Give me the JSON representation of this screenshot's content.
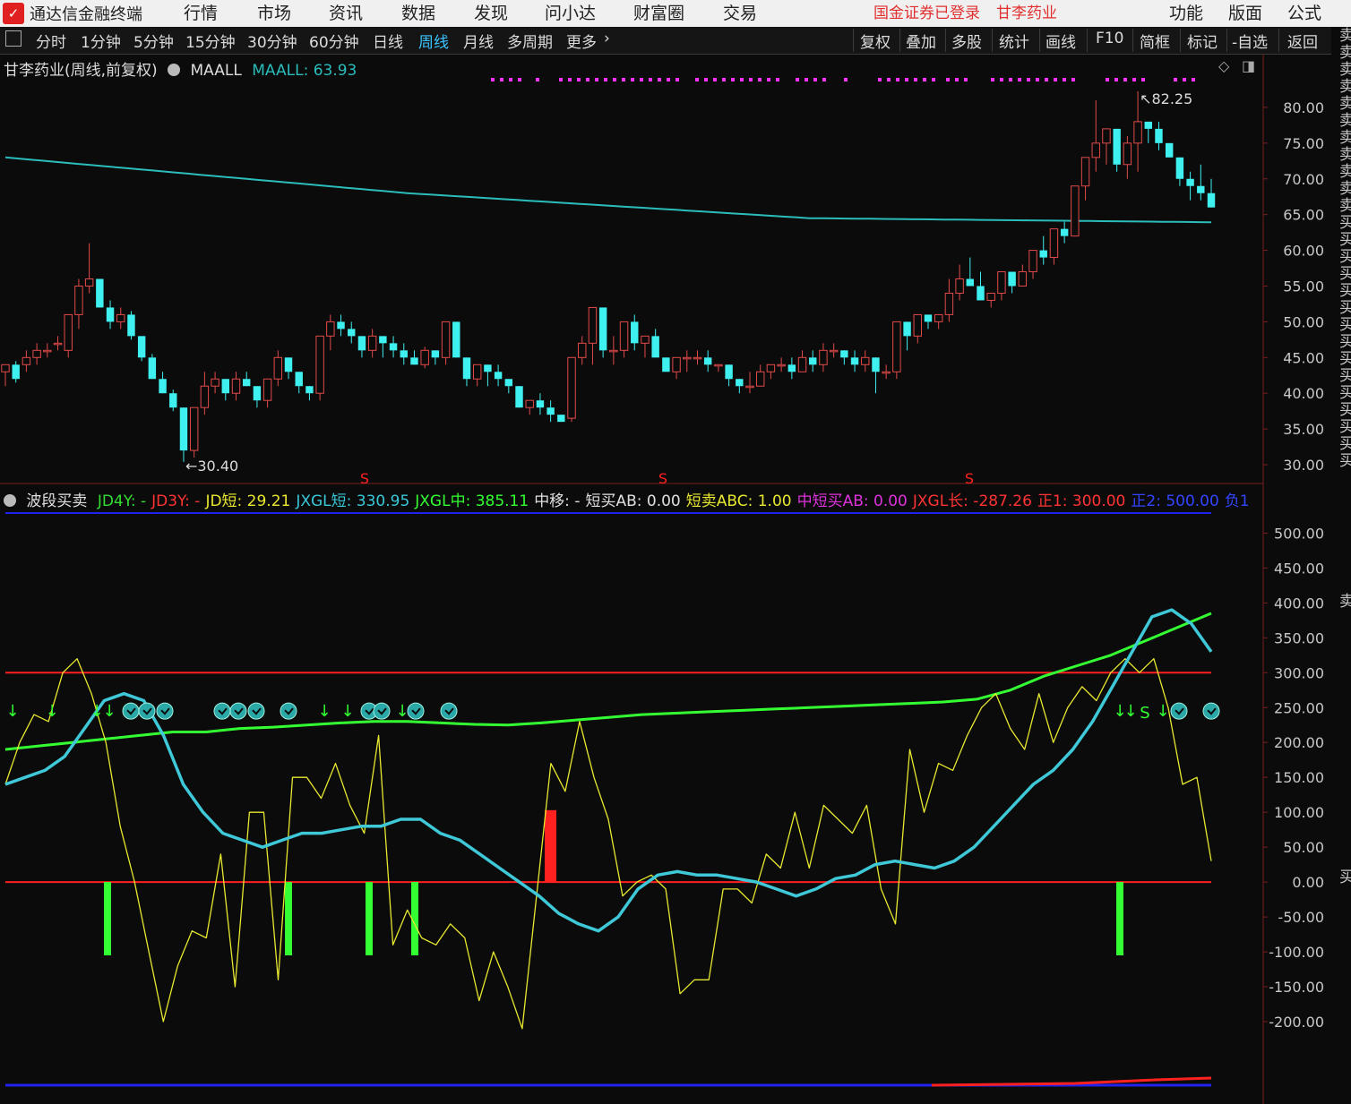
{
  "app": {
    "logo_text": "✓",
    "title": "通达信金融终端",
    "login_status": "国金证券已登录",
    "stock_name": "甘李药业"
  },
  "menu": {
    "main": [
      "行情",
      "市场",
      "资讯",
      "数据",
      "发现",
      "问小达",
      "财富圈",
      "交易"
    ],
    "right": [
      "功能",
      "版面",
      "公式"
    ]
  },
  "toolbar": {
    "periods": [
      "分时",
      "1分钟",
      "5分钟",
      "15分钟",
      "30分钟",
      "60分钟",
      "日线",
      "周线",
      "月线",
      "多周期",
      "更多"
    ],
    "selected": "周线",
    "right_buttons": [
      "复权",
      "叠加",
      "多股",
      "统计",
      "画线",
      "F10",
      "简框",
      "标记",
      "-自选",
      "返回"
    ]
  },
  "main_chart": {
    "title": "甘李药业(周线,前复权)",
    "indicator_name": "MAALL",
    "indicator_label": "MAALL: 63.93",
    "high_marker": "82.25",
    "low_marker": "30.40",
    "signal_marker": "S",
    "y_ticks": [
      "80.00",
      "75.00",
      "70.00",
      "65.00",
      "60.00",
      "55.00",
      "50.00",
      "45.00",
      "40.00",
      "35.00",
      "30.00"
    ]
  },
  "sub_chart": {
    "name": "波段买卖",
    "fields": [
      {
        "text": "JD4Y: -",
        "color": "#33dd33"
      },
      {
        "text": "JD3Y: -",
        "color": "#ff3333"
      },
      {
        "text": "JD短: 29.21",
        "color": "#e8e830"
      },
      {
        "text": "JXGL短: 330.95",
        "color": "#39c8d8"
      },
      {
        "text": "JXGL中: 385.11",
        "color": "#33ff33"
      },
      {
        "text": "中移: -",
        "color": "#e0e0e0"
      },
      {
        "text": "短买AB: 0.00",
        "color": "#e0e0e0"
      },
      {
        "text": "短卖ABC: 1.00",
        "color": "#e8e830"
      },
      {
        "text": "中短买AB: 0.00",
        "color": "#dd33dd"
      },
      {
        "text": "JXGL长: -287.26",
        "color": "#ff3333"
      },
      {
        "text": "正1: 300.00",
        "color": "#ff3333"
      },
      {
        "text": "正2: 500.00",
        "color": "#3344ff"
      },
      {
        "text": "负1",
        "color": "#3344ff"
      }
    ],
    "y_ticks": [
      "500.00",
      "450.00",
      "400.00",
      "350.00",
      "300.00",
      "250.00",
      "200.00",
      "150.00",
      "100.00",
      "50.00",
      "0.00",
      "-50.00",
      "-100.00",
      "-150.00",
      "-200.00"
    ]
  },
  "right_strip": {
    "top": "卖卖卖卖卖卖卖卖卖卖卖买买买买买买买买买买买买买买买",
    "mid": "卖",
    "low": "买"
  },
  "colors": {
    "up": "#e24a4a",
    "down": "#3ff0f0",
    "ma": "#2bbcbc",
    "yellow": "#e8e830",
    "cyan": "#3ec8d8",
    "green": "#33ff33",
    "red": "#ff2020",
    "blue": "#2222ee",
    "magenta": "#ff33ff"
  },
  "chart_data": [
    {
      "type": "candlestick",
      "title": "甘李药业(周线,前复权)",
      "ylim": [
        28,
        84
      ],
      "series": [
        {
          "name": "K线",
          "ohlc": [
            [
              43,
              44,
              41,
              44
            ],
            [
              44,
              44.5,
              41.5,
              42
            ],
            [
              44,
              46,
              43,
              45
            ],
            [
              45,
              47,
              44,
              46
            ],
            [
              46,
              47,
              45,
              46
            ],
            [
              47,
              48,
              46,
              47
            ],
            [
              46,
              51,
              45,
              51
            ],
            [
              51,
              56,
              49,
              55
            ],
            [
              55,
              61,
              54,
              56
            ],
            [
              56,
              56,
              52,
              52
            ],
            [
              52,
              53,
              49,
              50
            ],
            [
              50,
              52,
              49,
              51
            ],
            [
              51,
              51.5,
              47.5,
              48
            ],
            [
              48,
              48,
              44.5,
              45
            ],
            [
              45,
              45.5,
              42,
              42
            ],
            [
              42,
              43,
              40,
              40
            ],
            [
              40,
              40.5,
              37.5,
              38
            ],
            [
              38,
              38,
              30.4,
              32
            ],
            [
              32,
              38,
              31,
              38
            ],
            [
              38,
              43,
              37,
              41
            ],
            [
              41,
              43,
              40,
              42
            ],
            [
              42,
              42,
              39,
              40
            ],
            [
              40,
              43,
              39,
              42
            ],
            [
              42,
              43,
              41,
              41
            ],
            [
              41,
              41,
              38,
              39
            ],
            [
              39,
              42,
              38,
              42
            ],
            [
              42,
              46,
              41,
              45
            ],
            [
              45,
              45,
              42,
              43
            ],
            [
              43,
              43,
              40,
              41
            ],
            [
              41,
              41,
              39,
              40
            ],
            [
              40,
              47,
              39,
              48
            ],
            [
              48,
              51,
              46,
              50
            ],
            [
              50,
              51,
              48,
              49
            ],
            [
              49,
              50,
              47,
              48
            ],
            [
              48,
              48,
              45,
              46
            ],
            [
              46,
              49,
              45,
              48
            ],
            [
              48,
              48,
              45,
              47
            ],
            [
              47,
              48,
              45,
              46
            ],
            [
              46,
              47,
              44,
              45
            ],
            [
              45,
              46,
              44,
              44
            ],
            [
              44,
              46.5,
              43.5,
              46
            ],
            [
              46,
              46,
              44,
              45
            ],
            [
              45,
              50,
              44,
              50
            ],
            [
              50,
              50,
              45,
              45
            ],
            [
              45,
              45,
              41,
              42
            ],
            [
              42,
              44,
              41,
              44
            ],
            [
              44,
              44,
              41,
              43
            ],
            [
              43,
              44,
              41,
              42
            ],
            [
              42,
              42,
              40,
              41
            ],
            [
              41,
              41,
              38,
              38
            ],
            [
              38,
              39,
              37,
              39
            ],
            [
              39,
              40,
              37,
              38
            ],
            [
              38,
              39,
              36,
              37
            ],
            [
              37,
              37,
              36,
              36
            ],
            [
              36.5,
              45,
              36,
              45
            ],
            [
              45,
              48,
              44,
              47
            ],
            [
              47,
              52,
              44,
              52
            ],
            [
              52,
              52,
              45,
              46
            ],
            [
              46,
              48,
              44,
              46
            ],
            [
              46,
              50,
              45,
              50
            ],
            [
              50,
              51,
              46,
              47
            ],
            [
              47,
              47,
              45,
              48
            ],
            [
              48,
              49,
              45,
              45
            ],
            [
              45,
              45,
              44,
              43
            ],
            [
              43,
              45,
              42,
              45
            ],
            [
              45,
              46,
              43,
              45
            ],
            [
              45,
              46,
              44,
              45
            ],
            [
              45,
              46,
              43,
              44
            ],
            [
              44,
              44,
              43,
              44
            ],
            [
              44,
              44,
              41,
              42
            ],
            [
              42,
              42,
              40,
              41
            ],
            [
              41,
              43,
              40,
              41
            ],
            [
              41,
              44,
              41,
              43
            ],
            [
              43,
              44,
              42,
              44
            ],
            [
              44,
              45,
              43,
              44
            ],
            [
              44,
              45,
              42,
              43
            ],
            [
              43,
              46,
              43,
              45
            ],
            [
              45,
              46,
              43,
              44
            ],
            [
              44,
              47,
              43,
              46
            ],
            [
              46,
              47,
              45,
              46
            ],
            [
              46,
              46,
              44,
              45
            ],
            [
              45,
              46,
              43,
              44
            ],
            [
              44,
              46,
              43,
              45
            ],
            [
              45,
              45,
              40,
              43
            ],
            [
              43,
              44,
              42,
              43
            ],
            [
              43,
              50,
              42,
              50
            ],
            [
              50,
              50,
              46,
              48
            ],
            [
              48,
              51,
              47,
              51
            ],
            [
              51,
              51,
              49,
              50
            ],
            [
              50,
              51,
              49,
              51
            ],
            [
              51,
              56,
              50,
              54
            ],
            [
              54,
              58,
              53,
              56
            ],
            [
              56,
              59,
              55,
              55
            ],
            [
              55,
              57,
              53,
              53
            ],
            [
              53,
              54,
              52,
              54
            ],
            [
              54,
              57,
              53,
              57
            ],
            [
              57,
              57,
              54,
              55
            ],
            [
              55,
              58,
              55,
              57
            ],
            [
              57,
              60,
              56,
              60
            ],
            [
              60,
              62,
              58,
              59
            ],
            [
              59,
              63,
              58,
              63
            ],
            [
              63,
              64,
              61,
              62
            ],
            [
              62,
              69,
              62,
              69
            ],
            [
              69,
              73,
              67,
              73
            ],
            [
              73,
              81,
              71,
              75
            ],
            [
              75,
              77,
              72,
              77
            ],
            [
              77,
              77,
              71,
              72
            ],
            [
              72,
              76,
              70,
              75
            ],
            [
              75,
              82.25,
              71,
              78
            ],
            [
              78,
              78,
              75,
              77
            ],
            [
              77,
              78,
              74,
              75
            ],
            [
              75,
              75,
              73,
              73
            ],
            [
              73,
              73,
              69,
              70
            ],
            [
              70,
              71,
              67,
              69
            ],
            [
              69,
              72,
              67,
              68
            ],
            [
              68,
              70,
              66,
              66
            ]
          ]
        },
        {
          "name": "MAALL",
          "values": [
            73,
            68,
            64.5,
            63.93
          ]
        }
      ]
    },
    {
      "type": "line",
      "title": "波段买卖",
      "ylim": [
        -250,
        530
      ],
      "series": [
        {
          "name": "JD短",
          "values": [
            140,
            200,
            240,
            230,
            300,
            320,
            270,
            200,
            80,
            0,
            -100,
            -200,
            -120,
            -70,
            -80,
            40,
            -150,
            100,
            100,
            -140,
            150,
            150,
            120,
            170,
            110,
            70,
            210,
            -90,
            -40,
            -80,
            -90,
            -60,
            -80,
            -170,
            -100,
            -150,
            -210,
            -20,
            170,
            130,
            230,
            150,
            90,
            -20,
            0,
            10,
            -10,
            -160,
            -140,
            -140,
            -10,
            -10,
            -30,
            40,
            20,
            100,
            20,
            110,
            90,
            70,
            110,
            -10,
            -60,
            190,
            100,
            170,
            160,
            210,
            250,
            270,
            220,
            190,
            270,
            200,
            250,
            280,
            260,
            300,
            320,
            300,
            320,
            250,
            140,
            150,
            30
          ]
        },
        {
          "name": "JXGL短",
          "values": [
            140,
            150,
            160,
            180,
            220,
            260,
            270,
            260,
            210,
            140,
            100,
            70,
            60,
            50,
            60,
            70,
            70,
            75,
            80,
            80,
            90,
            90,
            70,
            60,
            40,
            20,
            0,
            -20,
            -45,
            -60,
            -70,
            -50,
            -10,
            10,
            15,
            10,
            10,
            5,
            0,
            -10,
            -20,
            -10,
            5,
            10,
            25,
            30,
            25,
            20,
            30,
            50,
            80,
            110,
            140,
            160,
            190,
            230,
            280,
            330,
            380,
            390,
            370,
            330
          ]
        },
        {
          "name": "JXGL中",
          "values": [
            190,
            195,
            200,
            205,
            210,
            215,
            215,
            220,
            222,
            225,
            228,
            230,
            230,
            228,
            226,
            225,
            228,
            232,
            236,
            240,
            242,
            244,
            246,
            248,
            250,
            252,
            254,
            256,
            258,
            262,
            275,
            295,
            310,
            325,
            345,
            365,
            385
          ]
        },
        {
          "name": "正1",
          "values": [
            300
          ]
        },
        {
          "name": "正2",
          "values": [
            500
          ]
        }
      ]
    }
  ]
}
